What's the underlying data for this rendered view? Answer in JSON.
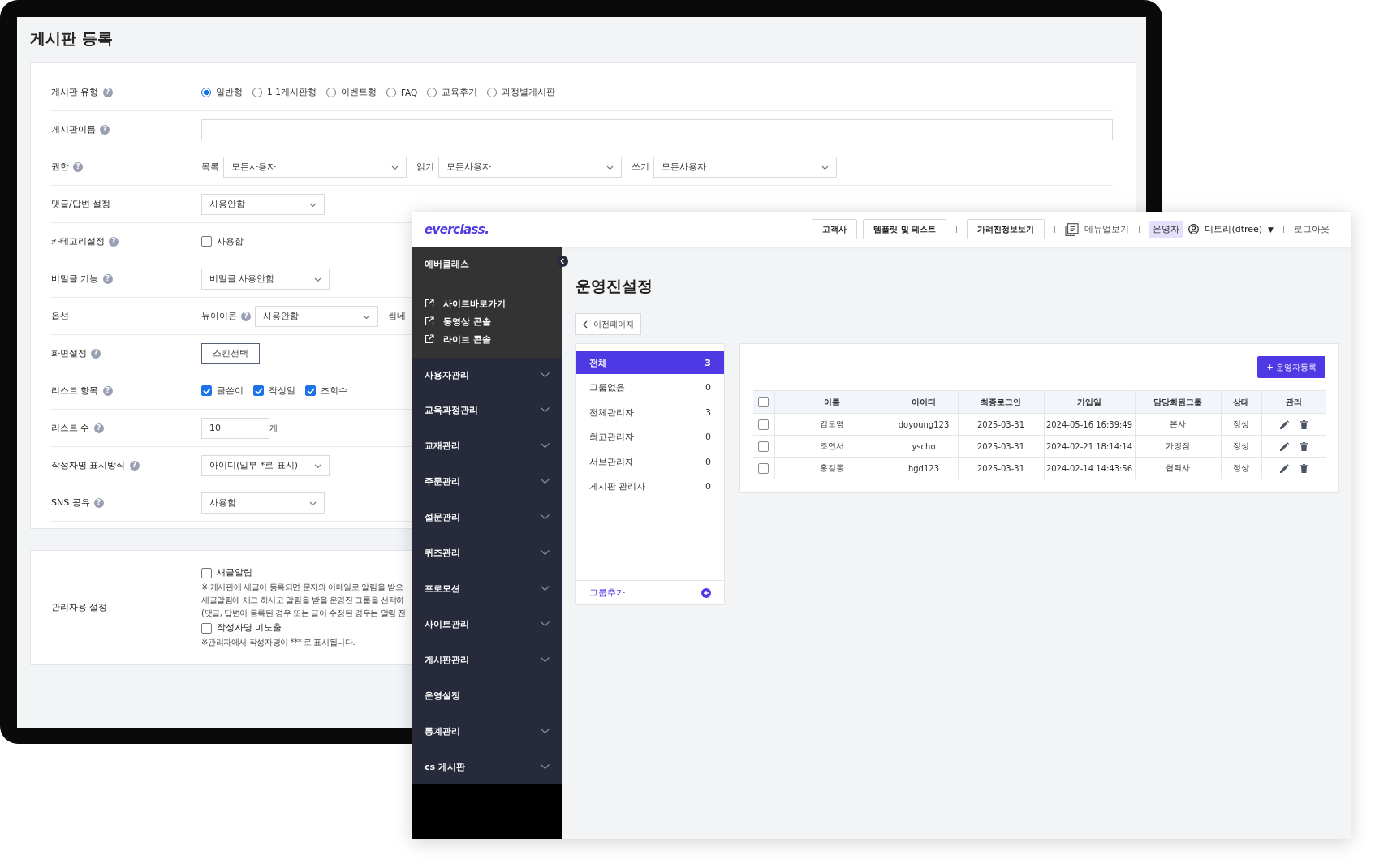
{
  "back_window": {
    "title": "게시판 등록",
    "rows": [
      {
        "kind": "radios",
        "label": "게시판 유형",
        "help": "?",
        "options": [
          {
            "label": "일반형",
            "selected": true
          },
          {
            "label": "1:1게시판형",
            "selected": false
          },
          {
            "label": "이벤트형",
            "selected": false
          },
          {
            "label": "FAQ",
            "selected": false
          },
          {
            "label": "교육후기",
            "selected": false
          },
          {
            "label": "과정별게시판",
            "selected": false
          }
        ]
      },
      {
        "kind": "input",
        "label": "게시판이름",
        "help": "?"
      },
      {
        "kind": "selects",
        "label": "권한",
        "help": "?",
        "fields": [
          {
            "label": "목록",
            "value": "모든사용자"
          },
          {
            "label": "읽기",
            "value": "모든사용자"
          },
          {
            "label": "쓰기",
            "value": "모든사용자"
          }
        ]
      },
      {
        "kind": "select",
        "label": "댓글/답변 설정",
        "value": "사용안함"
      },
      {
        "kind": "checkboxes",
        "label": "카테고리설정",
        "help": "?",
        "options": [
          {
            "label": "사용함",
            "checked": false
          }
        ]
      },
      {
        "kind": "select",
        "label": "비밀글 기능",
        "help": "?",
        "value": "비밀글 사용안함"
      },
      {
        "kind": "selects",
        "label": "옵션",
        "fields": [
          {
            "label": "뉴아이콘",
            "help": "?",
            "value": "사용안함"
          },
          {
            "label": "썸네"
          }
        ]
      },
      {
        "kind": "button",
        "label": "화면설정",
        "help": "?",
        "button": "스킨선택"
      },
      {
        "kind": "checkboxes",
        "label": "리스트 항목",
        "help": "?",
        "options": [
          {
            "label": "글쓴이",
            "checked": true
          },
          {
            "label": "작성일",
            "checked": true
          },
          {
            "label": "조회수",
            "checked": true
          }
        ]
      },
      {
        "kind": "count",
        "label": "리스트 수",
        "help": "?",
        "value": "10",
        "unit": "개"
      },
      {
        "kind": "select",
        "label": "작성자명 표시방식",
        "help": "?",
        "value": "아이디(일부 *로 표시)"
      },
      {
        "kind": "select",
        "label": "SNS 공유",
        "help": "?",
        "value": "사용함"
      }
    ],
    "admin": {
      "label": "관리자용 설정",
      "items": [
        {
          "kind": "checkbox",
          "label": "새글알림",
          "checked": false
        },
        {
          "kind": "note",
          "text": "※ 게시판에 새글이 등록되면 문자와 이메일로 알림을 받으"
        },
        {
          "kind": "note",
          "text": "새글알림에 체크 하시고 알림을 받을 운영진 그룹을 선택하"
        },
        {
          "kind": "note",
          "text": "(댓글, 답변이 등록된 경우 또는 글이 수정된 경우는 알림 전"
        },
        {
          "kind": "checkbox",
          "label": "작성자명 미노출",
          "checked": false
        },
        {
          "kind": "note",
          "text": "※관리자에서 작성자명이 *** 로 표시됩니다."
        }
      ]
    }
  },
  "front_window": {
    "logo": "everclass.",
    "header_buttons": [
      "고객사",
      "템플릿 및 테스트",
      "가려진정보보기"
    ],
    "manual_link": "메뉴얼보기",
    "role_badge": "운영자",
    "user": "디트리(dtree)",
    "user_caret": "▼",
    "logout": "로그아웃",
    "sidebar": {
      "title": "에버클래스",
      "links": [
        "사이트바로가기",
        "동영상 콘솔",
        "라이브 콘솔"
      ],
      "menu": [
        {
          "label": "사용자관리",
          "expandable": true
        },
        {
          "label": "교육과정관리",
          "expandable": true
        },
        {
          "label": "교재관리",
          "expandable": true
        },
        {
          "label": "주문관리",
          "expandable": true
        },
        {
          "label": "설문관리",
          "expandable": true
        },
        {
          "label": "퀴즈관리",
          "expandable": true
        },
        {
          "label": "프로모션",
          "expandable": true
        },
        {
          "label": "사이트관리",
          "expandable": true
        },
        {
          "label": "게시판관리",
          "expandable": true
        },
        {
          "label": "운영설정",
          "expandable": false
        },
        {
          "label": "통계관리",
          "expandable": true
        },
        {
          "label": "cs 게시판",
          "expandable": true
        }
      ]
    },
    "page_title": "운영진설정",
    "back_button": "이전페이지",
    "groups": [
      {
        "label": "전체",
        "count": "3",
        "selected": true
      },
      {
        "label": "그룹없음",
        "count": "0",
        "selected": false
      },
      {
        "label": "전체관리자",
        "count": "3",
        "selected": false
      },
      {
        "label": "최고관리자",
        "count": "0",
        "selected": false
      },
      {
        "label": "서브관리자",
        "count": "0",
        "selected": false
      },
      {
        "label": "게시판 관리자",
        "count": "0",
        "selected": false
      }
    ],
    "add_group": "그룹추가",
    "register_button": "+ 운영자등록",
    "table": {
      "header_checked": false,
      "columns": [
        "이름",
        "아이디",
        "최종로그인",
        "가입일",
        "담당회원그룹",
        "상태",
        "관리"
      ],
      "rows": [
        {
          "checked": false,
          "cells": [
            "김도영",
            "doyoung123",
            "2025-03-31",
            "2024-05-16 16:39:49",
            "본사",
            "정상"
          ]
        },
        {
          "checked": false,
          "cells": [
            "조연서",
            "yscho",
            "2025-03-31",
            "2024-02-21 18:14:14",
            "가맹점",
            "정상"
          ]
        },
        {
          "checked": false,
          "cells": [
            "홍길동",
            "hgd123",
            "2025-03-31",
            "2024-02-14 14:43:56",
            "협력사",
            "정상"
          ]
        }
      ]
    }
  }
}
